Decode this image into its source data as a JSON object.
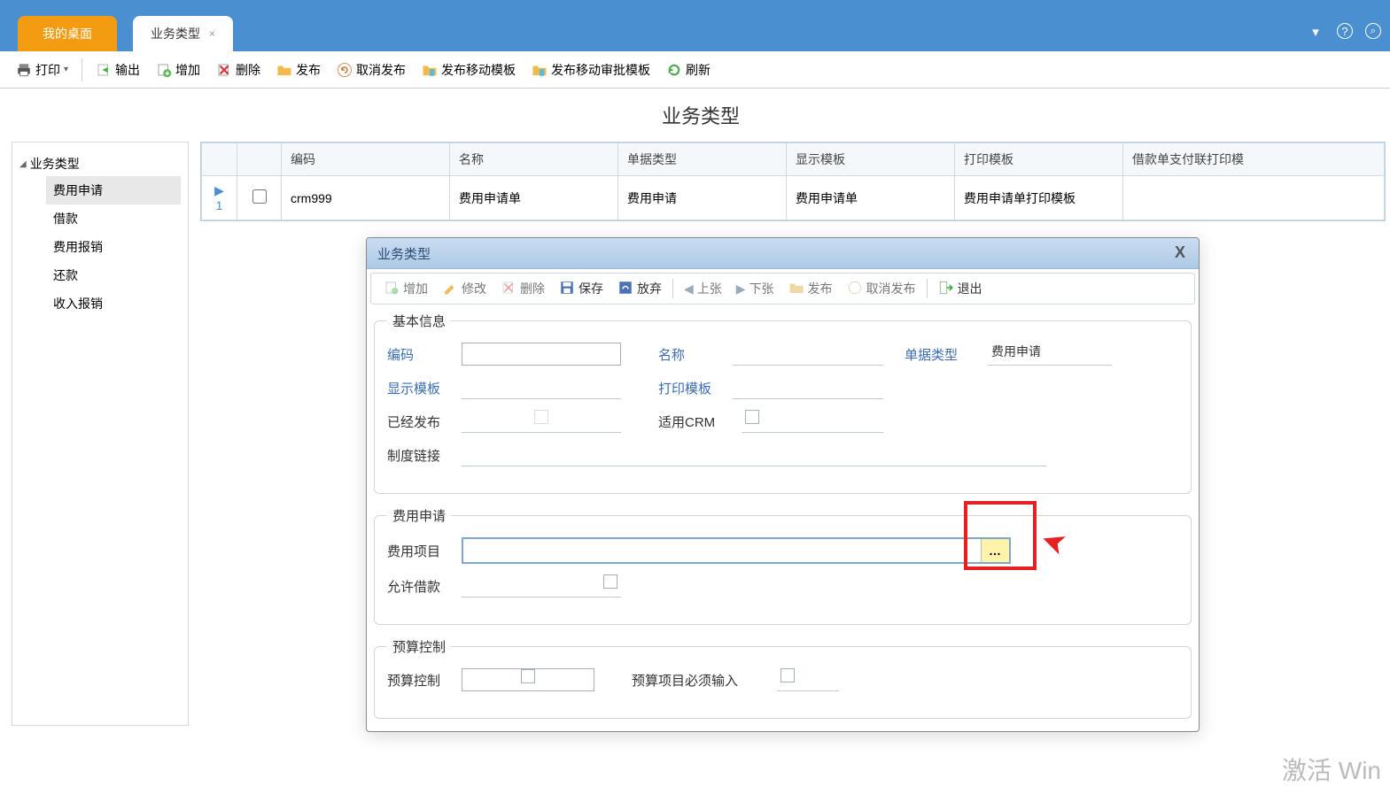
{
  "tabs": {
    "desktop": "我的桌面",
    "biz_type": "业务类型"
  },
  "toolbar": {
    "print": "打印",
    "export": "输出",
    "add": "增加",
    "delete": "删除",
    "publish": "发布",
    "unpublish": "取消发布",
    "publish_mobile_tpl": "发布移动模板",
    "publish_mobile_approve_tpl": "发布移动审批模板",
    "refresh": "刷新"
  },
  "page_title": "业务类型",
  "tree": {
    "root": "业务类型",
    "items": [
      "费用申请",
      "借款",
      "费用报销",
      "还款",
      "收入报销"
    ]
  },
  "grid": {
    "headers": {
      "code": "编码",
      "name": "名称",
      "bill_type": "单据类型",
      "display_tpl": "显示模板",
      "print_tpl": "打印模板",
      "loan_pay_print": "借款单支付联打印模"
    },
    "rows": [
      {
        "idx": "1",
        "code": "crm999",
        "name": "费用申请单",
        "bill_type": "费用申请",
        "display_tpl": "费用申请单",
        "print_tpl": "费用申请单打印模板"
      }
    ]
  },
  "dialog": {
    "title": "业务类型",
    "toolbar": {
      "add": "增加",
      "edit": "修改",
      "delete": "删除",
      "save": "保存",
      "discard": "放弃",
      "prev": "上张",
      "next": "下张",
      "publish": "发布",
      "unpublish": "取消发布",
      "exit": "退出"
    },
    "group_basic": "基本信息",
    "group_fee_apply": "费用申请",
    "group_budget": "预算控制",
    "fields": {
      "code": "编码",
      "name": "名称",
      "bill_type": "单据类型",
      "bill_type_value": "费用申请",
      "display_tpl": "显示模板",
      "print_tpl": "打印模板",
      "published": "已经发布",
      "use_crm": "适用CRM",
      "policy_link": "制度链接",
      "fee_item": "费用项目",
      "allow_loan": "允许借款",
      "budget_ctrl": "预算控制",
      "budget_item_required": "预算项目必须输入"
    }
  },
  "watermark": "激活 Win"
}
